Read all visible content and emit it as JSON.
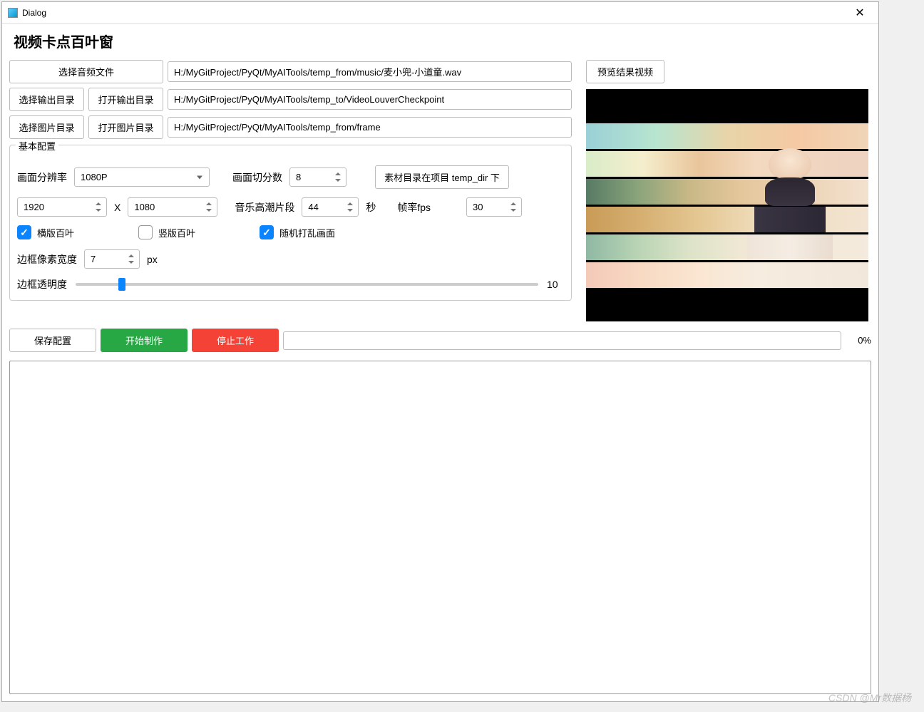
{
  "window": {
    "title": "Dialog"
  },
  "header": {
    "title": "视频卡点百叶窗"
  },
  "buttons": {
    "select_audio": "选择音频文件",
    "select_output_dir": "选择输出目录",
    "open_output_dir": "打开输出目录",
    "select_image_dir": "选择图片目录",
    "open_image_dir": "打开图片目录",
    "preview_result": "预览结果视频",
    "save_config": "保存配置",
    "start": "开始制作",
    "stop": "停止工作",
    "material_hint": "素材目录在项目 temp_dir 下"
  },
  "paths": {
    "audio": "H:/MyGitProject/PyQt/MyAITools/temp_from/music/麦小兜-小道童.wav",
    "output": "H:/MyGitProject/PyQt/MyAITools/temp_to/VideoLouverCheckpoint",
    "images": "H:/MyGitProject/PyQt/MyAITools/temp_from/frame"
  },
  "group": {
    "title": "基本配置"
  },
  "labels": {
    "resolution": "画面分辨率",
    "slices": "画面切分数",
    "x": "X",
    "climax": "音乐高潮片段",
    "seconds": "秒",
    "fps": "帧率fps",
    "horizontal": "横版百叶",
    "vertical": "竖版百叶",
    "shuffle": "随机打乱画面",
    "border_width": "边框像素宽度",
    "px": "px",
    "border_opacity": "边框透明度"
  },
  "values": {
    "resolution": "1080P",
    "width": "1920",
    "height": "1080",
    "slices": "8",
    "climax": "44",
    "fps": "30",
    "border_width": "7",
    "opacity": "10",
    "progress_pct": "0%"
  },
  "checks": {
    "horizontal": true,
    "vertical": false,
    "shuffle": true
  },
  "slider": {
    "pos_pct": 10
  },
  "watermark": "CSDN @Mr数据杨"
}
